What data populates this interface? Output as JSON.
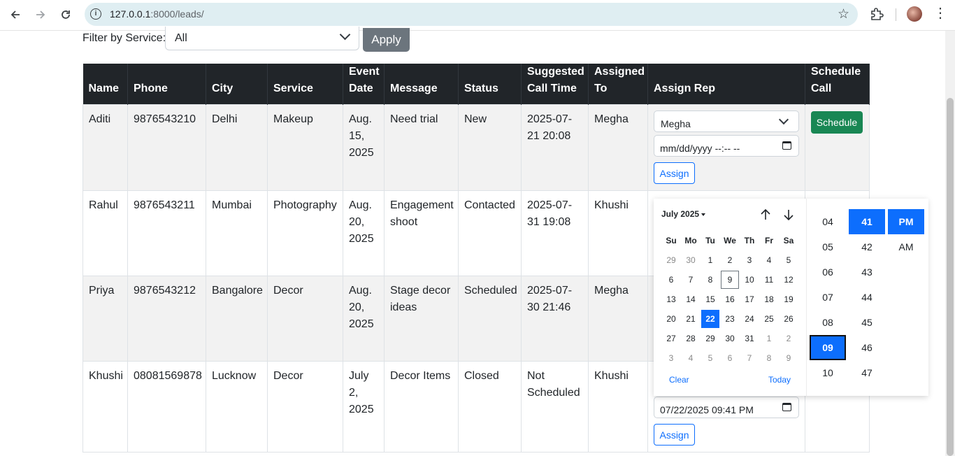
{
  "browser": {
    "url_host": "127.0.0.1",
    "url_path": ":8000/leads/"
  },
  "filter": {
    "label": "Filter by Service:",
    "selected": "All",
    "apply_label": "Apply"
  },
  "table": {
    "headers": [
      "Name",
      "Phone",
      "City",
      "Service",
      "Event Date",
      "Message",
      "Status",
      "Suggested Call Time",
      "Assigned To",
      "Assign Rep",
      "Schedule Call"
    ],
    "rows": [
      {
        "name": "Aditi",
        "phone": "9876543210",
        "city": "Delhi",
        "service": "Makeup",
        "event_date": "Aug. 15, 2025",
        "message": "Need trial",
        "status": "New",
        "suggested": "2025-07-21 20:08",
        "assigned": "Megha"
      },
      {
        "name": "Rahul",
        "phone": "9876543211",
        "city": "Mumbai",
        "service": "Photography",
        "event_date": "Aug. 20, 2025",
        "message": "Engagement shoot",
        "status": "Contacted",
        "suggested": "2025-07-31 19:08",
        "assigned": "Khushi"
      },
      {
        "name": "Priya",
        "phone": "9876543212",
        "city": "Bangalore",
        "service": "Decor",
        "event_date": "Aug. 20, 2025",
        "message": "Stage decor ideas",
        "status": "Scheduled",
        "suggested": "2025-07-30 21:46",
        "assigned": "Megha"
      },
      {
        "name": "Khushi",
        "phone": "08081569878",
        "city": "Lucknow",
        "service": "Decor",
        "event_date": "July 2, 2025",
        "message": "Decor Items",
        "status": "Closed",
        "suggested": "Not Scheduled",
        "assigned": "Khushi"
      }
    ],
    "row1_controls": {
      "rep_selected": "Megha",
      "datetime_placeholder": "mm/dd/yyyy --:-- --",
      "assign_label": "Assign",
      "schedule_label": "Schedule"
    },
    "row4_controls": {
      "datetime_value": "07/22/2025 09:41 PM",
      "assign_label": "Assign"
    }
  },
  "picker": {
    "month_label": "July 2025",
    "weekdays": [
      "Su",
      "Mo",
      "Tu",
      "We",
      "Th",
      "Fr",
      "Sa"
    ],
    "days": [
      {
        "d": "29",
        "muted": true
      },
      {
        "d": "30",
        "muted": true
      },
      {
        "d": "1"
      },
      {
        "d": "2"
      },
      {
        "d": "3"
      },
      {
        "d": "4"
      },
      {
        "d": "5"
      },
      {
        "d": "6"
      },
      {
        "d": "7"
      },
      {
        "d": "8"
      },
      {
        "d": "9",
        "today": true
      },
      {
        "d": "10"
      },
      {
        "d": "11"
      },
      {
        "d": "12"
      },
      {
        "d": "13"
      },
      {
        "d": "14"
      },
      {
        "d": "15"
      },
      {
        "d": "16"
      },
      {
        "d": "17"
      },
      {
        "d": "18"
      },
      {
        "d": "19"
      },
      {
        "d": "20"
      },
      {
        "d": "21"
      },
      {
        "d": "22",
        "selected": true
      },
      {
        "d": "23"
      },
      {
        "d": "24"
      },
      {
        "d": "25"
      },
      {
        "d": "26"
      },
      {
        "d": "27"
      },
      {
        "d": "28"
      },
      {
        "d": "29"
      },
      {
        "d": "30"
      },
      {
        "d": "31"
      },
      {
        "d": "1",
        "muted": true
      },
      {
        "d": "2",
        "muted": true
      },
      {
        "d": "3",
        "muted": true
      },
      {
        "d": "4",
        "muted": true
      },
      {
        "d": "5",
        "muted": true
      },
      {
        "d": "6",
        "muted": true
      },
      {
        "d": "7",
        "muted": true
      },
      {
        "d": "8",
        "muted": true
      },
      {
        "d": "9",
        "muted": true
      }
    ],
    "clear_label": "Clear",
    "today_label": "Today",
    "hours": [
      "04",
      "05",
      "06",
      "07",
      "08",
      "09",
      "10"
    ],
    "selected_hour": "09",
    "minutes": [
      "41",
      "42",
      "43",
      "44",
      "45",
      "46",
      "47"
    ],
    "selected_minute": "41",
    "meridiem": [
      "PM",
      "AM"
    ],
    "selected_meridiem": "PM"
  },
  "colors": {
    "header_bg": "#212529",
    "primary": "#0d6efd",
    "success": "#198754",
    "secondary": "#6c757d"
  }
}
